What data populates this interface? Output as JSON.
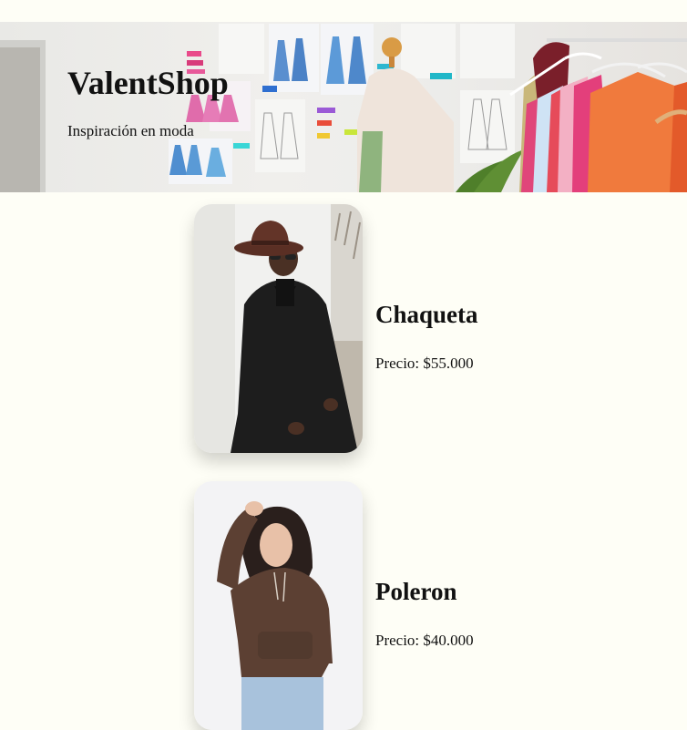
{
  "header": {
    "title": "ValentShop",
    "subtitle": "Inspiración en moda"
  },
  "products": [
    {
      "name": "Chaqueta",
      "price": "Precio: $55.000",
      "image": "man-in-black-coat-and-hat"
    },
    {
      "name": "Poleron",
      "price": "Precio: $40.000",
      "image": "woman-in-brown-hoodie"
    }
  ],
  "colors": {
    "page_background": "#fefef6",
    "text": "#111111"
  }
}
